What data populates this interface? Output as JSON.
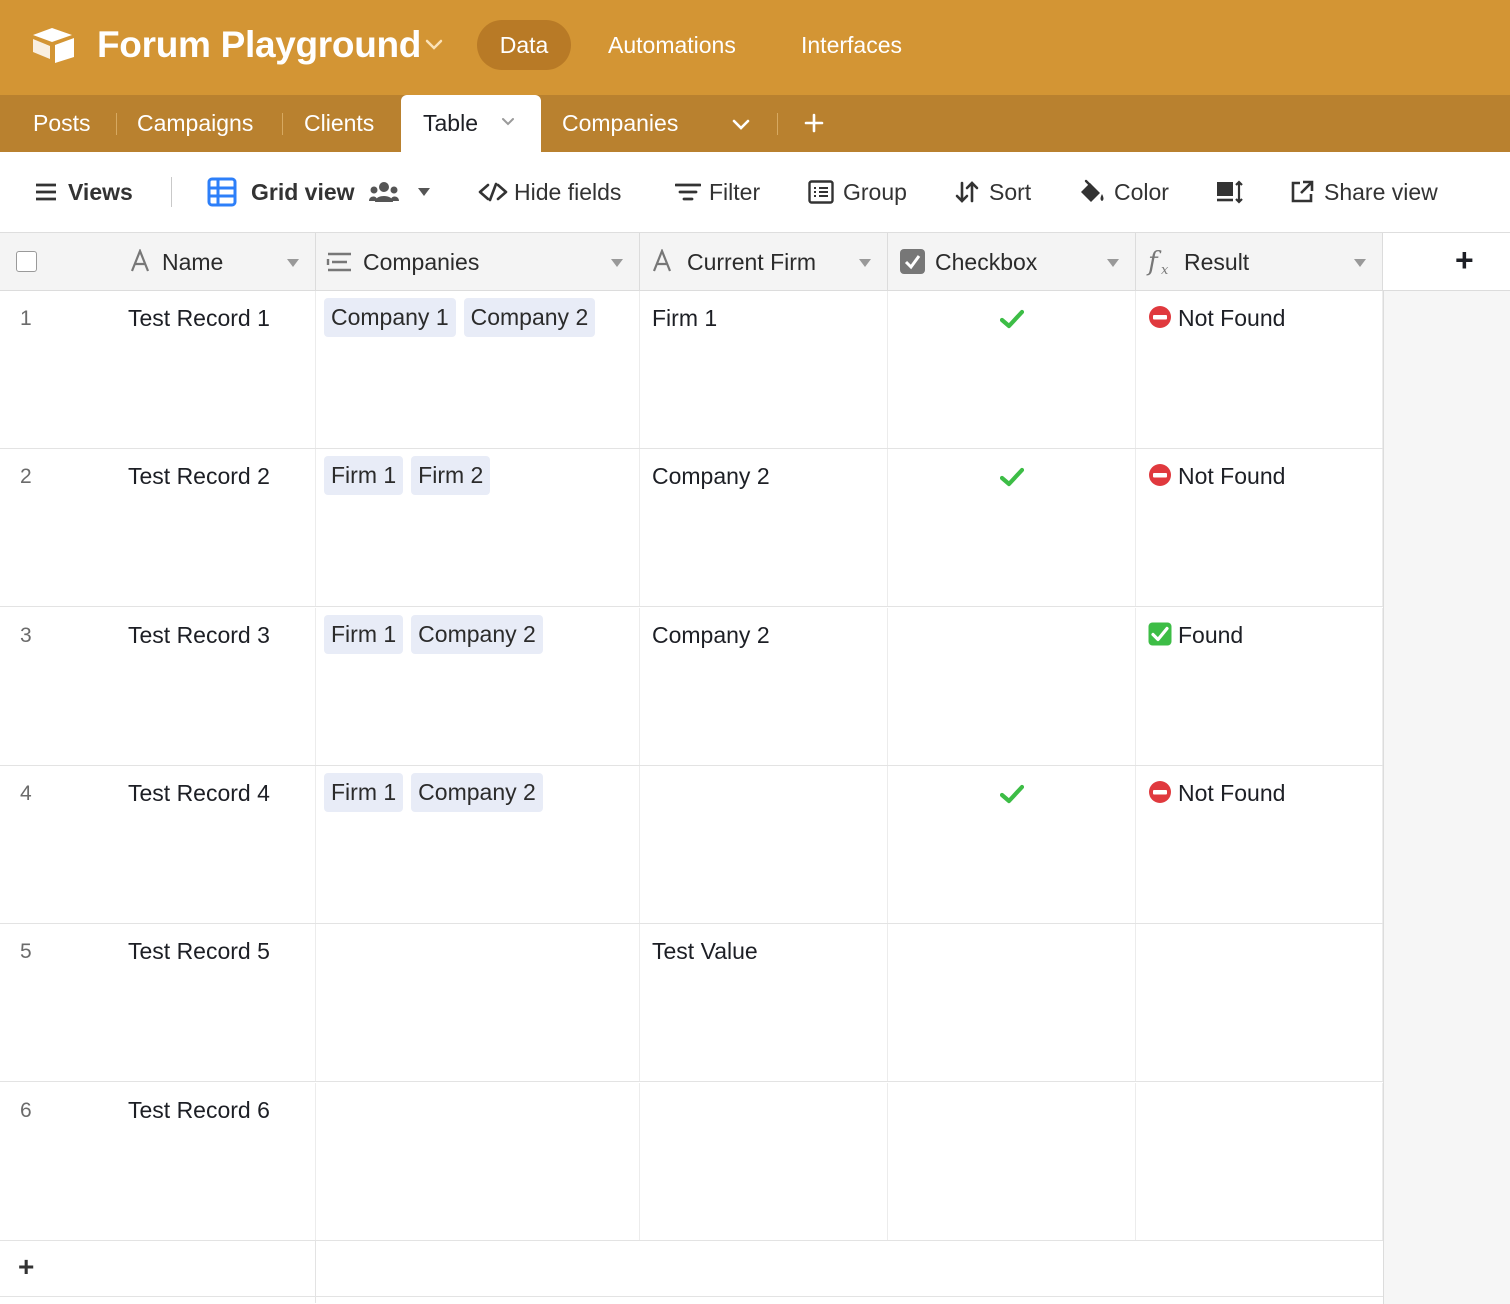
{
  "app": {
    "base_title": "Forum Playground",
    "nav": {
      "data": "Data",
      "automations": "Automations",
      "interfaces": "Interfaces"
    }
  },
  "tables": {
    "items": [
      "Posts",
      "Campaigns",
      "Clients",
      "Table",
      "Companies"
    ],
    "active": "Table",
    "add_label": "+"
  },
  "toolbar": {
    "views": "Views",
    "grid_view": "Grid view",
    "hide_fields": "Hide fields",
    "filter": "Filter",
    "group": "Group",
    "sort": "Sort",
    "color": "Color",
    "share_view": "Share view"
  },
  "columns": {
    "name": "Name",
    "companies": "Companies",
    "current_firm": "Current Firm",
    "checkbox": "Checkbox",
    "result": "Result",
    "add": "+"
  },
  "rows": [
    {
      "num": "1",
      "name": "Test Record 1",
      "companies": [
        "Company 1",
        "Company 2"
      ],
      "current_firm": "Firm 1",
      "checked": true,
      "result": "Not Found",
      "result_icon": "no-entry-icon"
    },
    {
      "num": "2",
      "name": "Test Record 2",
      "companies": [
        "Firm 1",
        "Firm 2"
      ],
      "current_firm": "Company 2",
      "checked": true,
      "result": "Not Found",
      "result_icon": "no-entry-icon"
    },
    {
      "num": "3",
      "name": "Test Record 3",
      "companies": [
        "Firm 1",
        "Company 2"
      ],
      "current_firm": "Company 2",
      "checked": false,
      "result": "Found",
      "result_icon": "green-check-box-icon"
    },
    {
      "num": "4",
      "name": "Test Record 4",
      "companies": [
        "Firm 1",
        "Company 2"
      ],
      "current_firm": "",
      "checked": true,
      "result": "Not Found",
      "result_icon": "no-entry-icon"
    },
    {
      "num": "5",
      "name": "Test Record 5",
      "companies": [],
      "current_firm": "Test Value",
      "checked": false,
      "result": "",
      "result_icon": ""
    },
    {
      "num": "6",
      "name": "Test Record 6",
      "companies": [],
      "current_firm": "",
      "checked": false,
      "result": "",
      "result_icon": ""
    }
  ],
  "add_row_label": "+",
  "colors": {
    "topbar": "#d39534",
    "tabbar": "#b9812f",
    "active_pill": "#b87a26",
    "chip": "#e8ecf7",
    "check_green": "#3dbd46",
    "no_entry_red": "#e0393e"
  }
}
